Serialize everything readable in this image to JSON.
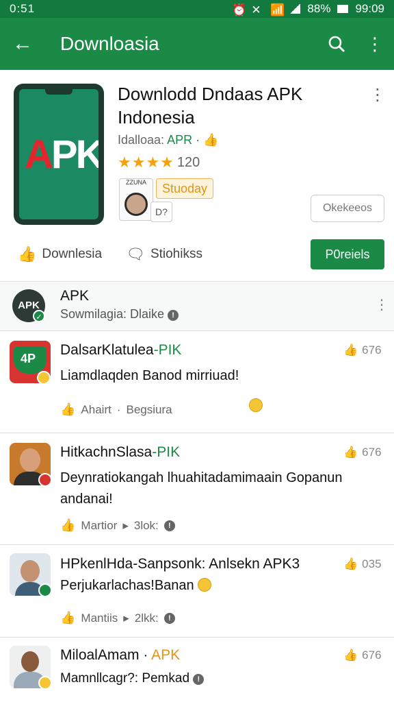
{
  "status_bar": {
    "time": "0:51",
    "battery": "88%",
    "clock": "99:09"
  },
  "app_bar": {
    "title": "Downloasia",
    "back_icon": "arrow-back-icon",
    "search_icon": "search-icon",
    "menu_icon": "more-vert-icon"
  },
  "app": {
    "title": "Downlodd Dndaas APK Indonesia",
    "developer": "Idalloaa:",
    "developer_tag": "APR",
    "rating_count": "120",
    "chip_sunday": "Stuoday",
    "chip_d": "D?",
    "badge_top": "ZZUNA",
    "outline_button": "Okekeeos",
    "like_label": "Downlesia",
    "comment_label": "Stiohikss",
    "install_label": "P0reiels"
  },
  "developer_row": {
    "name": "APK",
    "subtitle": "Sowmilagia: Dlaike",
    "avatar_text": "APK"
  },
  "reviews": [
    {
      "name": "DalsarKlatulea",
      "tag": "-PIK",
      "likes": "676",
      "text": "Liamdlaqden Banod mirriuad!",
      "meta_a": "Ahairt",
      "meta_b": "Begsiura"
    },
    {
      "name": "HitkachnSlasa",
      "tag": "-PIK",
      "likes": "676",
      "text": "Deynratiokangah lhuahitadamimaain Gopanun andanai!",
      "meta_a": "Martior",
      "meta_b": "3lok:"
    },
    {
      "name": "HPkenlHda",
      "tag": "-Sanpsonk: Anlsekn APK3",
      "likes": "035",
      "text": "Perjukarlachas!Banan",
      "meta_a": "Mantiis",
      "meta_b": "2lkk:"
    },
    {
      "name": "MiloalAmam",
      "tag": "APK",
      "likes": "676",
      "text": "Mamnllcagr?: Pemkad",
      "meta_a": "",
      "meta_b": ""
    }
  ]
}
